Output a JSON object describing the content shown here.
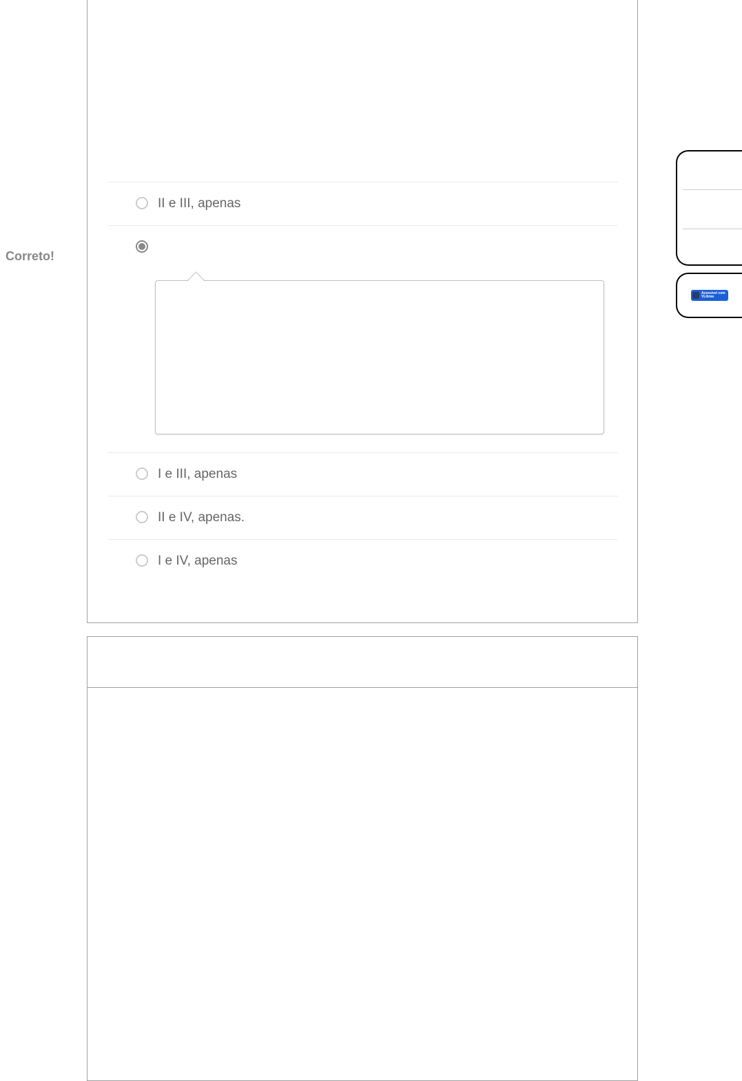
{
  "feedback": {
    "correct_label": "Correto!"
  },
  "question": {
    "answers": [
      {
        "label": "II e III, apenas",
        "selected": false
      },
      {
        "label": "",
        "selected": true
      },
      {
        "label": "I e III, apenas",
        "selected": false
      },
      {
        "label": "II e IV, apenas.",
        "selected": false
      },
      {
        "label": "I e IV, apenas",
        "selected": false
      }
    ]
  },
  "accessibility": {
    "line1": "Acessível com",
    "line2": "VLibras"
  }
}
